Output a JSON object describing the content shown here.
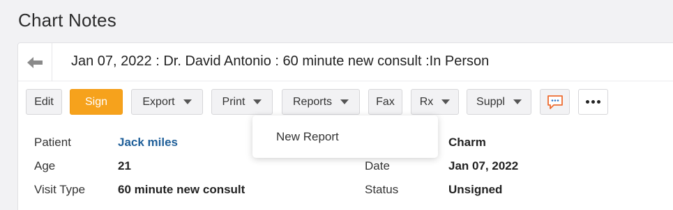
{
  "page": {
    "title": "Chart Notes"
  },
  "header": {
    "back_icon": "arrow-left-icon",
    "title": "Jan 07, 2022 : Dr. David Antonio : 60 minute new consult :In Person"
  },
  "toolbar": {
    "edit": "Edit",
    "sign": "Sign",
    "export": "Export",
    "print": "Print",
    "reports": "Reports",
    "fax": "Fax",
    "rx": "Rx",
    "suppl": "Suppl",
    "chat_icon": "chat-bubble-icon",
    "more_icon": "more-dots-icon",
    "sign_color": "#f6a21c",
    "chat_color": "#ee6b2f"
  },
  "reports_menu": {
    "items": [
      "New Report"
    ]
  },
  "details": {
    "patient_label": "Patient",
    "patient_value": "Jack miles",
    "age_label": "Age",
    "age_value": "21",
    "visit_type_label": "Visit Type",
    "visit_type_value": "60 minute new consult",
    "facility_value": "Charm",
    "date_label": "Date",
    "date_value": "Jan 07, 2022",
    "status_label": "Status",
    "status_value": "Unsigned"
  }
}
